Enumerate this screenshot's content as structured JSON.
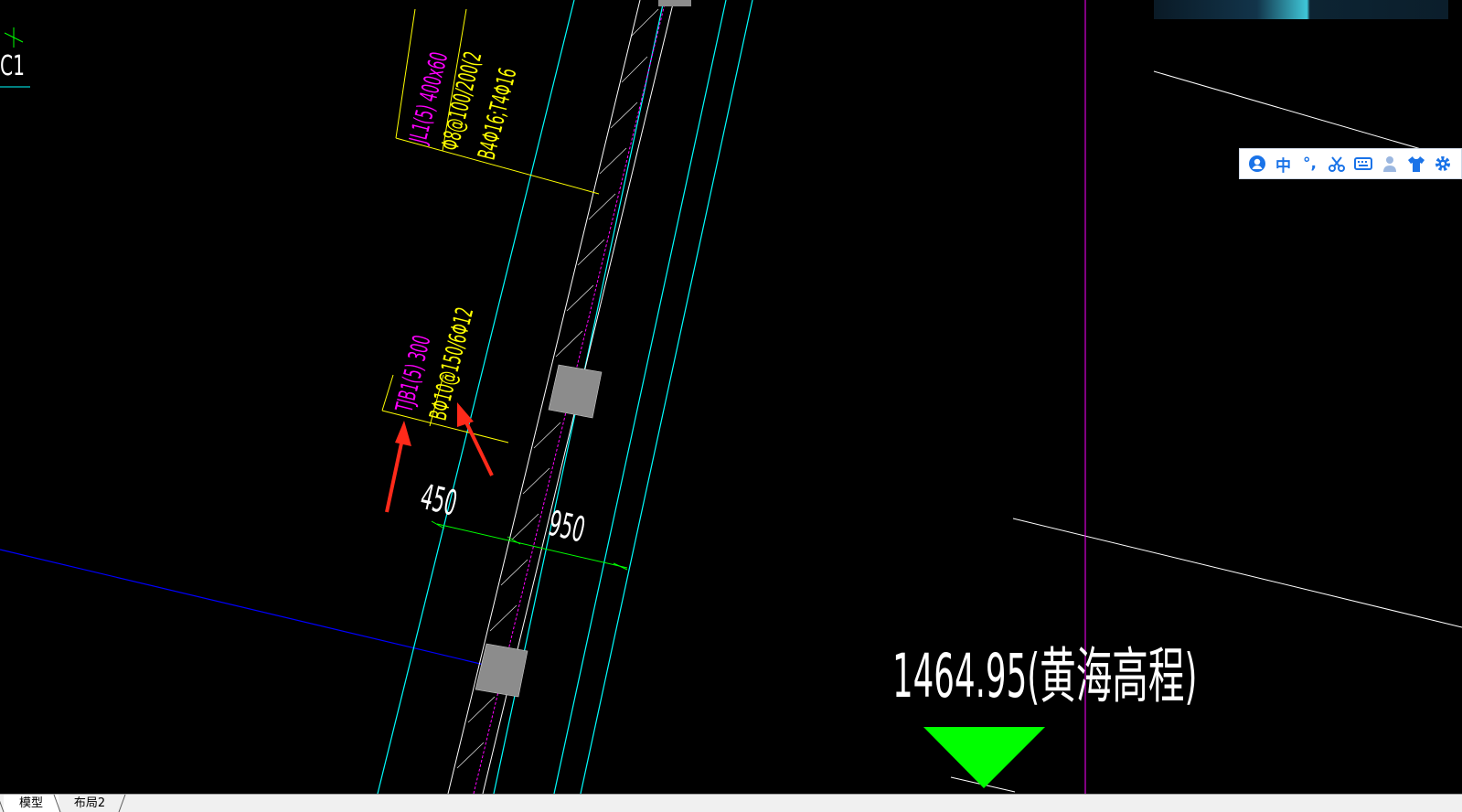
{
  "drawing": {
    "corner_label": "C1",
    "beam_label": {
      "line1": "JL1(5) 400x60",
      "line2": "Φ8@100/200(2",
      "line3": "B4Φ16;T4Φ16"
    },
    "strip_label": {
      "line1": "TJB1(5) 300",
      "line2": "BΦ10@150/6Φ12"
    },
    "dim_left": "450",
    "dim_right": "950",
    "elevation": "1464.95(黄海高程)",
    "colors": {
      "background": "#000000",
      "foundation_line": "#00ffff",
      "axis_line": "#ff00ff",
      "label_yellow": "#ffff00",
      "label_magenta": "#ff00ff",
      "dimension": "#00ff00",
      "elevation_marker": "#00ff00",
      "annotation_arrow": "#ff2a1a",
      "grid_blue": "#0000ff",
      "white_line": "#ffffff"
    }
  },
  "ime_toolbar": {
    "lang_label": "中",
    "punct_label": "°,",
    "icons": [
      "user-avatar-icon",
      "chinese-mode",
      "punctuation-icon",
      "scissors-icon",
      "keyboard-icon",
      "person-icon",
      "tshirt-skin-icon",
      "gear-icon"
    ],
    "accent": "#1a73e8"
  },
  "tabs": [
    {
      "label": "模型",
      "active": true
    },
    {
      "label": "布局2",
      "active": false
    }
  ]
}
